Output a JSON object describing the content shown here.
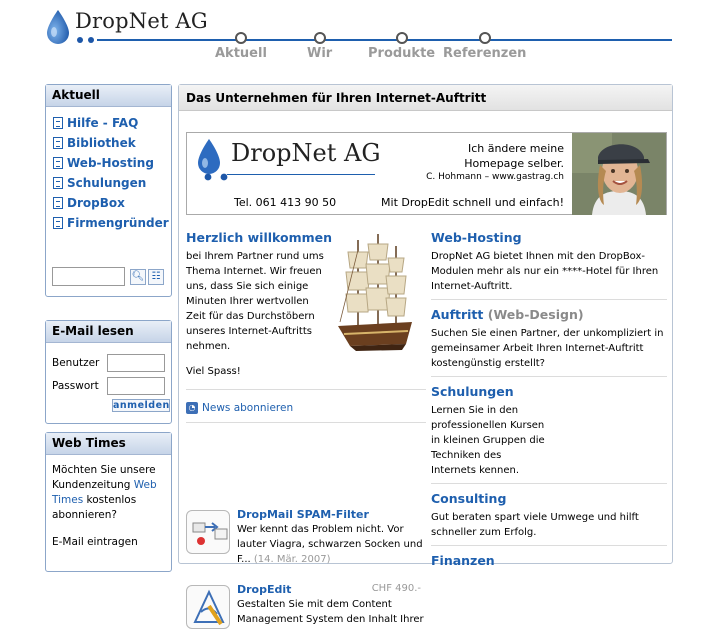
{
  "header": {
    "logo_text": "DropNet AG",
    "nav": [
      "Aktuell",
      "Wir",
      "Produkte",
      "Referenzen"
    ]
  },
  "sidebar": {
    "aktuell": {
      "title": "Aktuell",
      "items": [
        "Hilfe - FAQ",
        "Bibliothek",
        "Web-Hosting",
        "Schulungen",
        "DropBox",
        "Firmengründer"
      ]
    },
    "email": {
      "title": "E-Mail lesen",
      "user_label": "Benutzer",
      "password_label": "Passwort",
      "submit_label": "anmelden"
    },
    "webtimes": {
      "title": "Web Times",
      "text_before": "Möchten Sie unsere Kundenzeitung",
      "link": "Web Times",
      "text_after": "kostenlos abonnieren?",
      "more": "E-Mail eintragen"
    }
  },
  "main": {
    "title": "Das Unternehmen für Ihren Internet-Auftritt",
    "banner": {
      "name": "DropNet AG",
      "tel": "Tel. 061 413 90 50",
      "quote_line1": "Ich ändere meine",
      "quote_line2": "Homepage selber.",
      "author": "C. Hohmann – www.gastrag.ch",
      "slogan": "Mit DropEdit schnell und einfach!"
    },
    "welcome": {
      "title": "Herzlich willkommen",
      "text": "bei Ihrem Partner rund ums Thema Internet. Wir freuen uns, dass Sie sich einige Minuten Ihrer wertvollen Zeit für das Durchstöbern unseres Internet-Auftritts nehmen.",
      "closing": "Viel Spass!"
    },
    "news_label": "News abonnieren",
    "products": [
      {
        "title": "DropMail SPAM-Filter",
        "text": "Wer kennt das Problem nicht. Vor lauter Viagra, schwarzen Socken und F...",
        "date": "(14. Mär. 2007)",
        "price": ""
      },
      {
        "title": "DropEdit",
        "text": "Gestalten Sie mit dem Content Management System den Inhalt Ihrer",
        "date": "",
        "price": "CHF 490.-"
      }
    ],
    "right": [
      {
        "title": "Web-Hosting",
        "sub": "",
        "text": "DropNet AG bietet Ihnen mit den DropBox-Modulen mehr als nur ein ****-Hotel für Ihren Internet-Auftritt."
      },
      {
        "title": "Auftritt",
        "sub": "(Web-Design)",
        "text": "Suchen Sie einen Partner, der unkompliziert in gemeinsamer Arbeit Ihren Internet-Auftritt kostengünstig erstellt?"
      },
      {
        "title": "Schulungen",
        "sub": "",
        "text": "Lernen Sie in den professionellen Kursen in kleinen Gruppen die Techniken des Internets kennen."
      },
      {
        "title": "Consulting",
        "sub": "",
        "text": "Gut beraten spart viele Umwege und hilft schneller zum Erfolg."
      },
      {
        "title": "Finanzen",
        "sub": "",
        "text": ""
      }
    ]
  }
}
